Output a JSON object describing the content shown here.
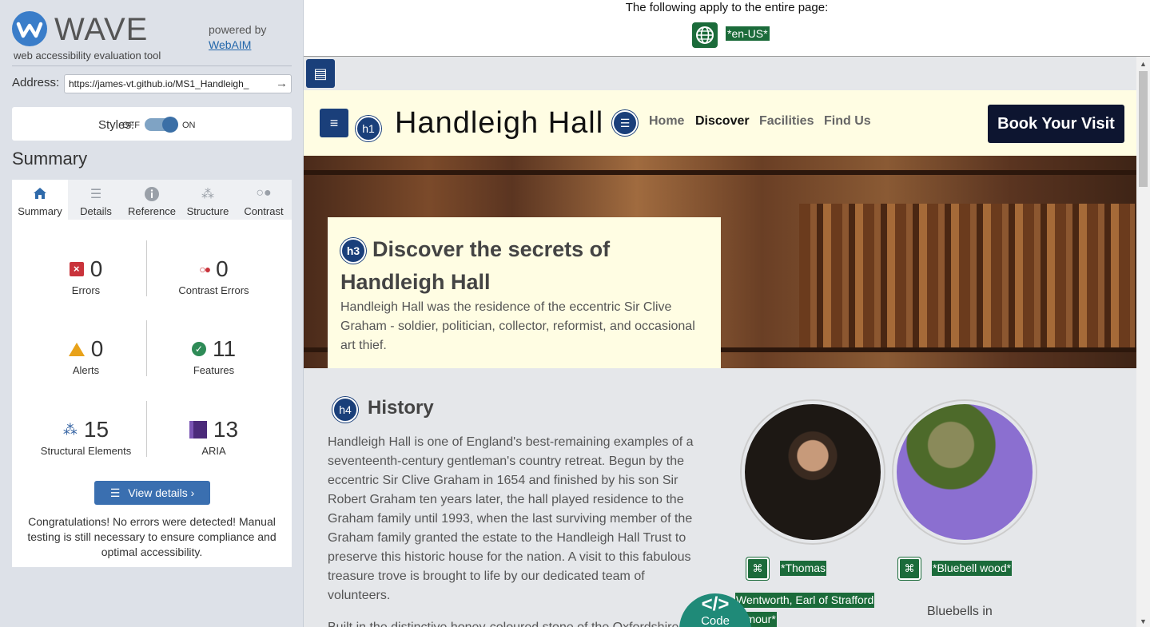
{
  "wave": {
    "title": "WAVE",
    "subtitle": "web accessibility evaluation tool",
    "powered_by": "powered by",
    "webaim_link": "WebAIM",
    "address_label": "Address:",
    "address_value": "https://james-vt.github.io/MS1_Handleigh_",
    "styles_label": "Styles:",
    "styles_off": "OFF",
    "styles_on": "ON",
    "summary_heading": "Summary",
    "tabs": [
      {
        "label": "Summary",
        "icon": "home-icon"
      },
      {
        "label": "Details",
        "icon": "list-icon"
      },
      {
        "label": "Reference",
        "icon": "info-icon"
      },
      {
        "label": "Structure",
        "icon": "hierarchy-icon"
      },
      {
        "label": "Contrast",
        "icon": "contrast-icon"
      }
    ],
    "stats": {
      "errors": {
        "value": "0",
        "label": "Errors"
      },
      "contrast": {
        "value": "0",
        "label": "Contrast Errors"
      },
      "alerts": {
        "value": "0",
        "label": "Alerts"
      },
      "features": {
        "value": "11",
        "label": "Features"
      },
      "structural": {
        "value": "15",
        "label": "Structural Elements"
      },
      "aria": {
        "value": "13",
        "label": "ARIA"
      }
    },
    "view_details": "View details ›",
    "congrats": "Congratulations! No errors were detected! Manual testing is still necessary to ensure compliance and optimal accessibility."
  },
  "page": {
    "applies_text": "The following apply to the entire page:",
    "lang_tag": "*en-US*",
    "site_title": "Handleigh Hall",
    "nav": [
      "Home",
      "Discover",
      "Facilities",
      "Find Us"
    ],
    "book_button": "Book Your Visit",
    "h1_badge": "h1",
    "h3_badge": "h3",
    "h4_badge": "h4",
    "hero_heading": "Discover the secrets of Handleigh Hall",
    "hero_text": "Handleigh Hall was the residence of the eccentric Sir Clive Graham - soldier, politician, collector, reformist, and occasional art thief.",
    "history_heading": "History",
    "history_text": "Handleigh Hall is one of England's best-remaining examples of a seventeenth-century gentleman's country retreat. Begun by the eccentric Sir Clive Graham in 1654 and finished by his son Sir Robert Graham ten years later, the hall played residence to the Graham family until 1993, when the last surviving member of the Graham family granted the estate to the Handleigh Hall Trust to preserve this historic house for the nation. A visit to this fabulous treasure trove is brought to life by our dedicated team of volunteers.",
    "history_text_2": "Built in the distinctive honey-coloured stone of the Oxfordshire",
    "alt_thomas_1": "*Thomas",
    "alt_thomas_2": "Wentworth, Earl of Strafford",
    "alt_thomas_3": "armour*",
    "alt_bluebell": "*Bluebell wood*",
    "bluebell_caption": "Bluebells in",
    "code_symbol": "</>",
    "code_label": "Code"
  }
}
